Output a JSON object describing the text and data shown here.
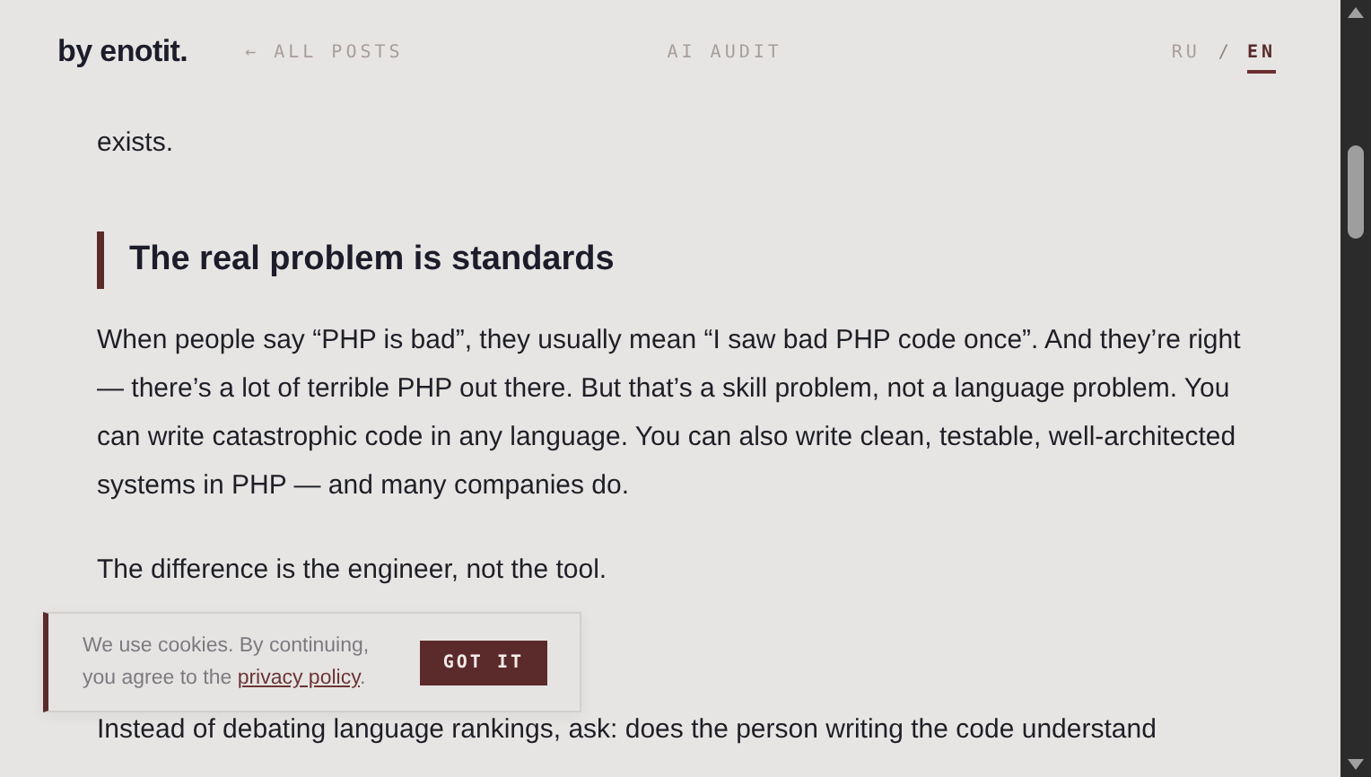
{
  "header": {
    "logo": "by enotit.",
    "back_link": "← ALL POSTS",
    "center_link": "AI AUDIT",
    "languages": [
      {
        "label": "RU",
        "selected": false
      },
      {
        "label": "EN",
        "selected": true
      }
    ],
    "separator": "/"
  },
  "article": {
    "blocks": [
      {
        "kind": "paragraph",
        "text": "exists."
      },
      {
        "kind": "heading",
        "text": "The real problem is standards"
      },
      {
        "kind": "paragraph",
        "text": "When people say “PHP is bad”, they usually mean “I saw bad PHP code once”. And they’re right — there’s a lot of terrible PHP out there. But that’s a skill problem, not a language problem. You can write catastrophic code in any language. You can also write clean, testable, well-architected systems in PHP — and many companies do."
      },
      {
        "kind": "paragraph",
        "text": "The difference is the engineer, not the tool."
      },
      {
        "kind": "gap"
      },
      {
        "kind": "paragraph",
        "text": "Instead of debating language rankings, ask: does the person writing the code understand"
      }
    ]
  },
  "cookie_banner": {
    "text_before": "We use cookies. By continuing, you agree to the ",
    "link": "privacy policy",
    "text_after": ".",
    "button": "GOT IT"
  }
}
